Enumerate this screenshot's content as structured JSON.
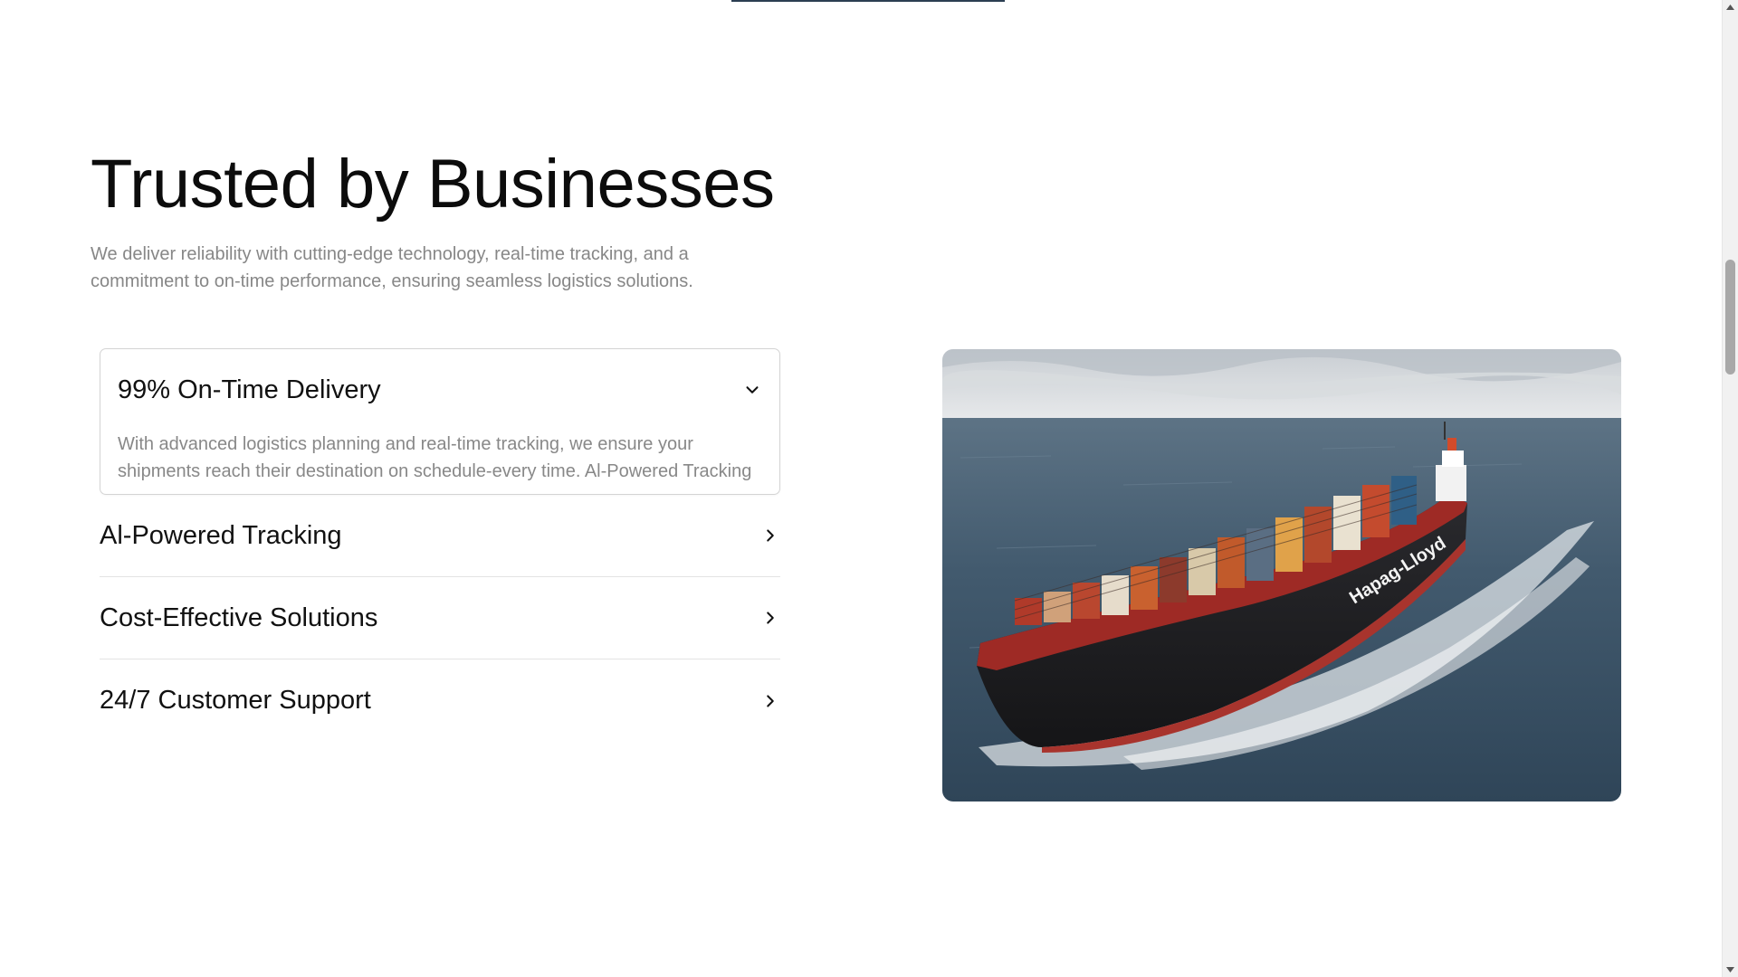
{
  "section": {
    "heading": "Trusted by Businesses",
    "subtext": "We deliver reliability with cutting-edge technology, real-time tracking, and a commitment to on-time performance, ensuring seamless logistics solutions."
  },
  "accordion": {
    "open_item": {
      "title": "99% On-Time Delivery",
      "body": "With advanced logistics planning and real-time tracking, we ensure your shipments reach their destination on schedule-every time. Al-Powered Tracking",
      "icon": "chevron-down-icon"
    },
    "items": [
      {
        "title": "Al-Powered Tracking",
        "icon": "chevron-right-icon"
      },
      {
        "title": "Cost-Effective Solutions",
        "icon": "chevron-right-icon"
      },
      {
        "title": "24/7 Customer Support",
        "icon": "chevron-right-icon"
      }
    ]
  },
  "image": {
    "subject": "container-ship-photo",
    "hull_text": "Hapag-Lloyd"
  },
  "colors": {
    "heading": "#0c0c0c",
    "muted_text": "#878787",
    "border": "#d4d4d4",
    "divider": "#e3e3e3",
    "sea": "#3e5468",
    "hull": "#1f1f22",
    "hull_red": "#9e2a25"
  }
}
